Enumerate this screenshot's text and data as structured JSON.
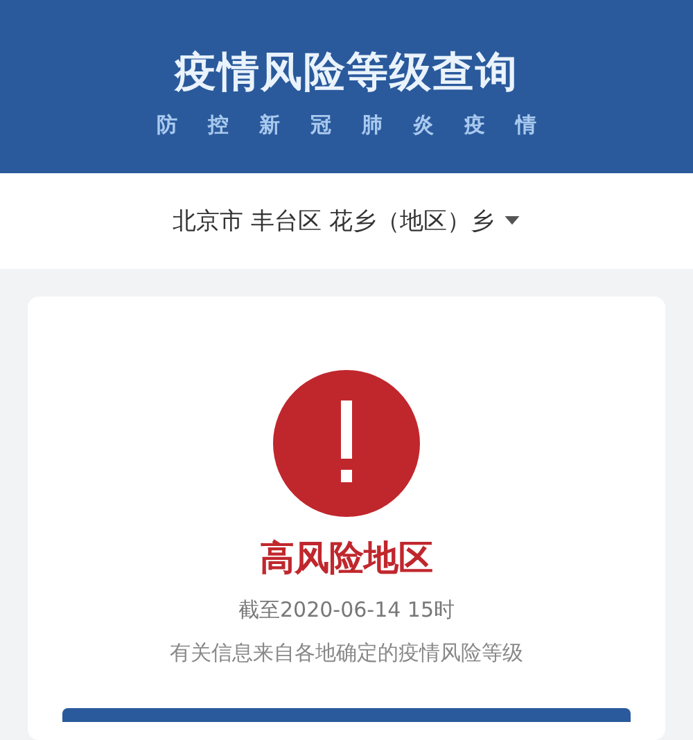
{
  "header": {
    "title": "疫情风险等级查询",
    "subtitle": "防控新冠肺炎疫情"
  },
  "location": {
    "text": "北京市 丰台区 花乡（地区）乡"
  },
  "result": {
    "kind": "high",
    "label": "高风险地区",
    "updated": "截至2020-06-14 15时",
    "note": "有关信息来自各地确定的疫情风险等级"
  }
}
